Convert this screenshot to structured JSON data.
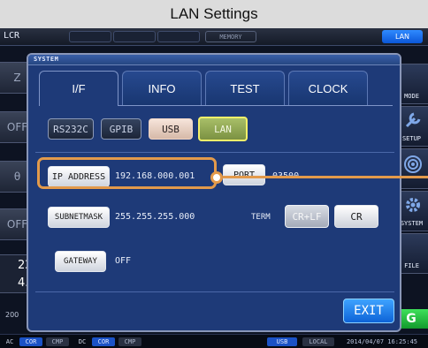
{
  "caption": "LAN Settings",
  "topbar": {
    "mode_label": "LCR",
    "memory": "MEMORY",
    "lan_badge": "LAN"
  },
  "background_left": {
    "buttons": [
      "Z",
      "OFF",
      "θ",
      "OFF"
    ],
    "value_1": "22",
    "value_2": "4.",
    "bottom_label": "200"
  },
  "background_right": {
    "items": [
      "MODE",
      "SETUP",
      "SYSTEM",
      "FILE"
    ],
    "green_label": "G"
  },
  "statusbar": {
    "items": [
      "AC",
      "COR",
      "CMP",
      "DC",
      "COR",
      "CMP"
    ],
    "usb": "USB",
    "local": "LOCAL",
    "datetime": "2014/04/07 16:25:45"
  },
  "dialog": {
    "title": "SYSTEM",
    "tabs": [
      "I/F",
      "INFO",
      "TEST",
      "CLOCK"
    ],
    "interfaces": [
      "RS232C",
      "GPIB",
      "USB",
      "LAN"
    ],
    "ip_address_label": "IP ADDRESS",
    "ip_address_value": "192.168.000.001",
    "port_label": "PORT",
    "port_value": "03500",
    "subnet_label": "SUBNETMASK",
    "subnet_value": "255.255.255.000",
    "term_label": "TERM",
    "term_options": [
      "CR+LF",
      "CR"
    ],
    "gateway_label": "GATEWAY",
    "gateway_value": "OFF",
    "exit_label": "EXIT"
  },
  "colors": {
    "callout": "#e39a4b",
    "dialog_bg": "#1e3a78",
    "selected_lan": "#8aa24e",
    "exit": "#1e7ff0"
  }
}
